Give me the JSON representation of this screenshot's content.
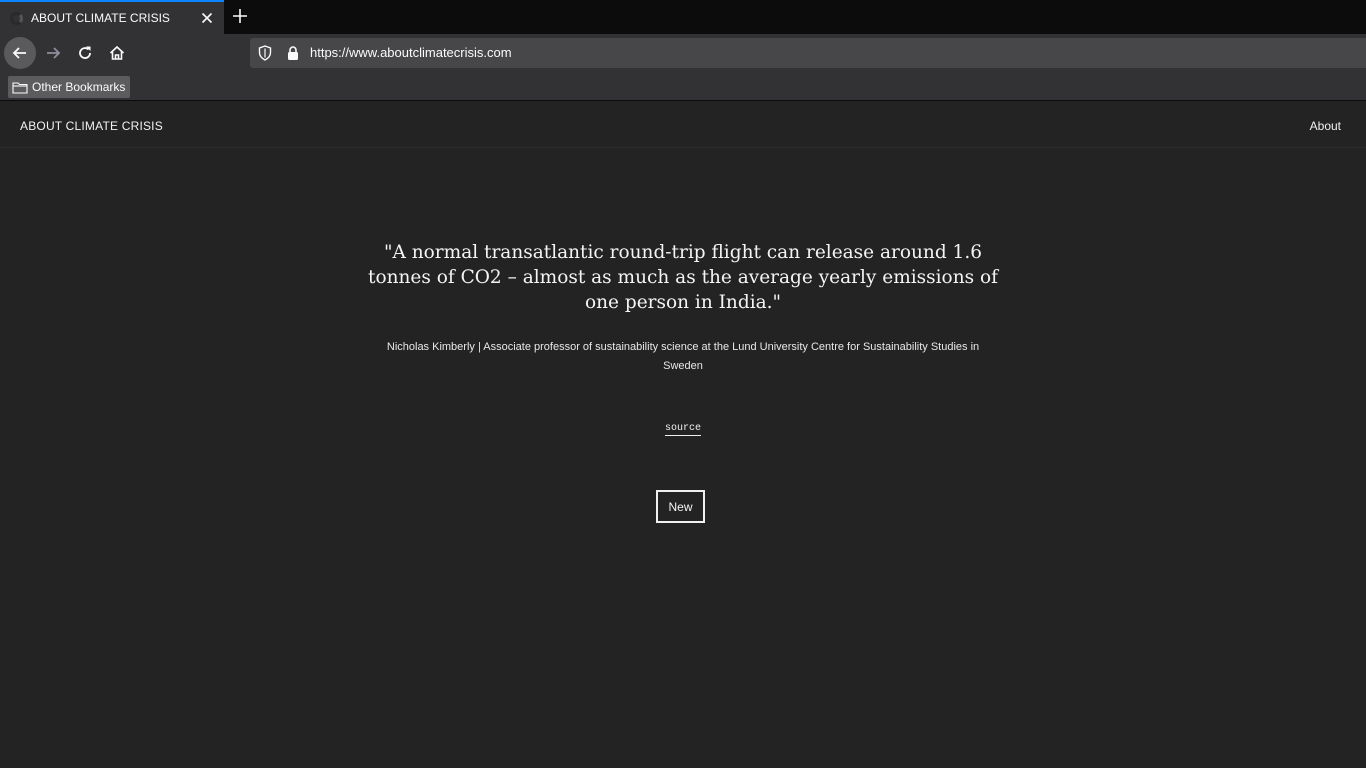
{
  "browser": {
    "tab": {
      "title": "ABOUT CLIMATE CRISIS"
    },
    "url": "https://www.aboutclimatecrisis.com",
    "bookmarks": [
      {
        "label": "Other Bookmarks",
        "icon": "folder-icon"
      }
    ],
    "colors": {
      "tab_accent": "#0a84ff",
      "chrome": "#323234",
      "tabstrip": "#0c0c0d"
    }
  },
  "site": {
    "title": "ABOUT CLIMATE CRISIS",
    "nav": {
      "about": "About"
    },
    "quote": "\"A normal transatlantic round-trip flight can release around 1.6 tonnes of CO2 – almost as much as the average yearly emissions of one person in India.\"",
    "attribution": "Nicholas Kimberly | Associate professor of sustainability science at the Lund University Centre for Sustainability Studies in Sweden",
    "source_label": "source",
    "new_button": "New",
    "colors": {
      "background": "#232323",
      "text": "#f0f0f0"
    }
  }
}
